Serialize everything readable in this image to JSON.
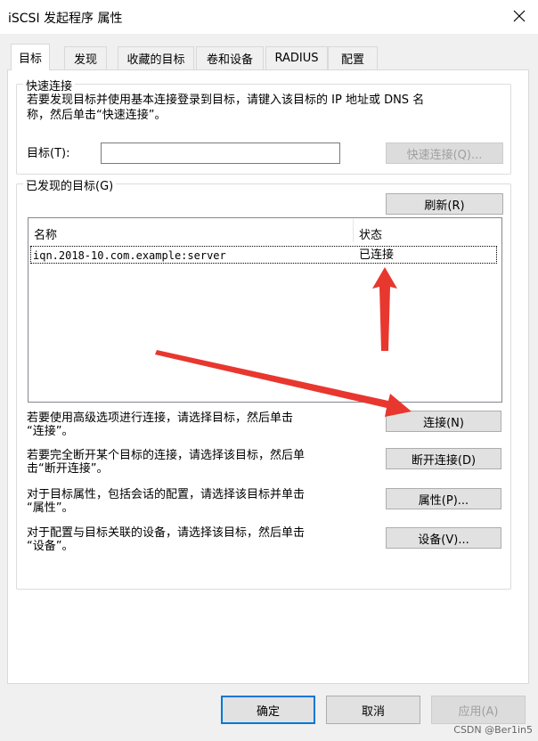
{
  "window": {
    "title": "iSCSI 发起程序 属性",
    "close_icon": "close-icon"
  },
  "tabs": [
    "目标",
    "发现",
    "收藏的目标",
    "卷和设备",
    "RADIUS",
    "配置"
  ],
  "quick_connect": {
    "legend": "快速连接",
    "description_line1": "若要发现目标并使用基本连接登录到目标，请键入该目标的 IP 地址或 DNS 名",
    "description_line2": "称，然后单击“快速连接”。",
    "target_label": "目标(T):",
    "target_value": "",
    "button_label": "快速连接(Q)..."
  },
  "discovered": {
    "legend": "已发现的目标(G)",
    "refresh_label": "刷新(R)",
    "columns": [
      "名称",
      "状态"
    ],
    "rows": [
      {
        "name": "iqn.2018-10.com.example:server",
        "status": "已连接"
      }
    ]
  },
  "actions": [
    {
      "line1": "若要使用高级选项进行连接，请选择目标，然后单击",
      "line2": "“连接”。",
      "button": "连接(N)"
    },
    {
      "line1": "若要完全断开某个目标的连接，请选择该目标，然后单",
      "line2": "击“断开连接”。",
      "button": "断开连接(D)"
    },
    {
      "line1": "对于目标属性，包括会话的配置，请选择该目标并单击",
      "line2": "“属性”。",
      "button": "属性(P)..."
    },
    {
      "line1": "对于配置与目标关联的设备，请选择该目标，然后单击",
      "line2": "“设备”。",
      "button": "设备(V)..."
    }
  ],
  "footer": {
    "ok": "确定",
    "cancel": "取消",
    "apply": "应用(A)"
  },
  "watermark": "CSDN @Ber1in5",
  "colors": {
    "arrow": "#e8372f",
    "focus": "#0078d7"
  }
}
